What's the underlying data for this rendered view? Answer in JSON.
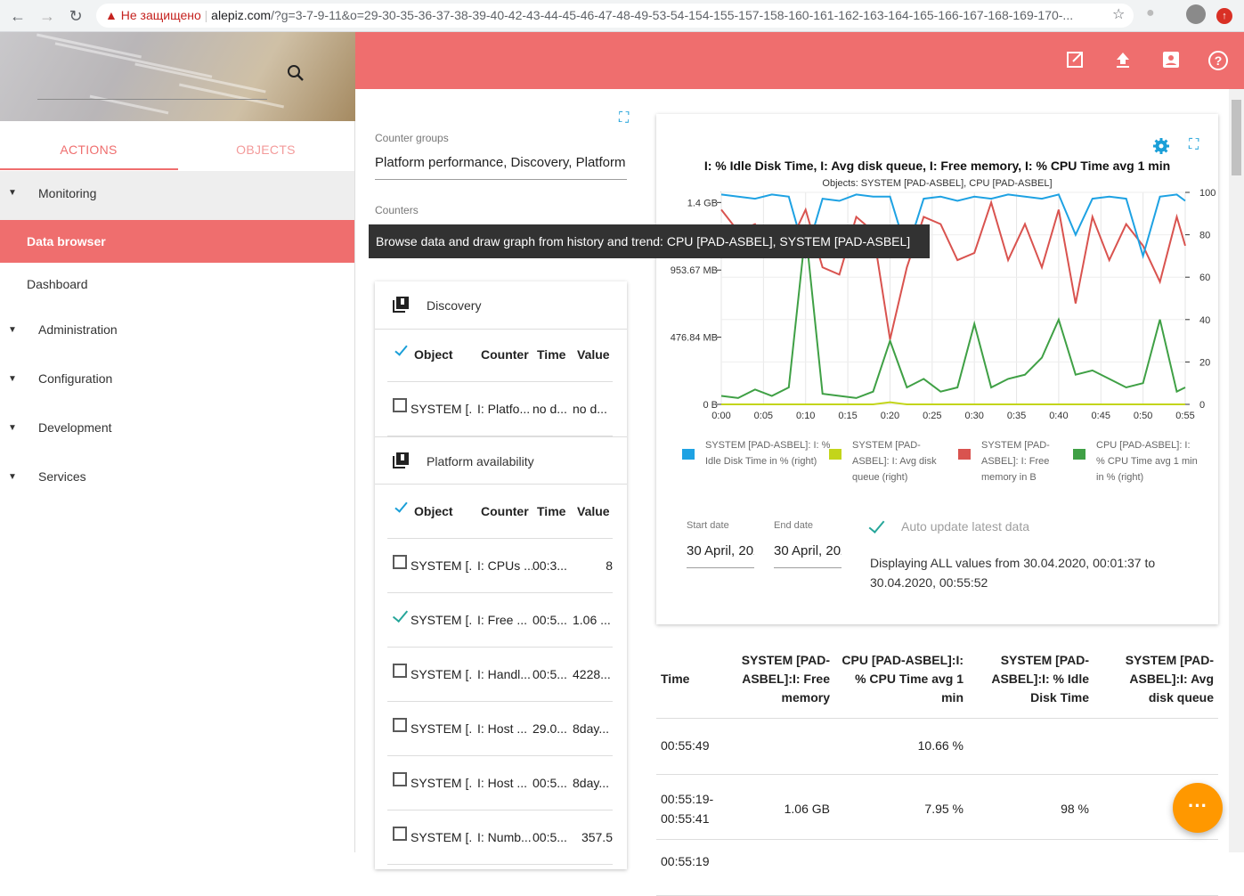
{
  "browser": {
    "warning": "Не защищено",
    "url_host": "alepiz.com",
    "url_path": "/?g=3-7-9-11&o=29-30-35-36-37-38-39-40-42-43-44-45-46-47-48-49-53-54-154-155-157-158-160-161-162-163-164-165-166-167-168-169-170-..."
  },
  "sidebar": {
    "tabs": [
      "ACTIONS",
      "OBJECTS"
    ],
    "menu": {
      "monitoring": "Monitoring",
      "data_browser": "Data browser",
      "dashboard": "Dashboard",
      "administration": "Administration",
      "configuration": "Configuration",
      "development": "Development",
      "services": "Services"
    }
  },
  "form": {
    "counter_groups_label": "Counter groups",
    "counter_groups_value": "Platform performance, Discovery, Platform availability",
    "counters_label": "Counters"
  },
  "tooltip": "Browse data and draw graph from history and trend: CPU [PAD-ASBEL], SYSTEM [PAD-ASBEL]",
  "counters": {
    "discovery": {
      "title": "Discovery",
      "headers": [
        "Object",
        "Counter",
        "Time",
        "Value"
      ],
      "rows": [
        {
          "object": "SYSTEM [...",
          "counter": "I: Platfo...",
          "time": "no d...",
          "value": "no d...",
          "checked": false
        }
      ]
    },
    "availability": {
      "title": "Platform availability",
      "headers": [
        "Object",
        "Counter",
        "Time",
        "Value"
      ],
      "rows": [
        {
          "object": "SYSTEM [...",
          "counter": "I: CPUs ...",
          "time": "00:3...",
          "value": "8"
        },
        {
          "object": "SYSTEM [...",
          "counter": "I: Free ...",
          "time": "00:5...",
          "value": "1.06 ..."
        },
        {
          "object": "SYSTEM [...",
          "counter": "I: Handl...",
          "time": "00:5...",
          "value": "4228..."
        },
        {
          "object": "SYSTEM [...",
          "counter": "I: Host ...",
          "time": "29.0...",
          "value": "8day..."
        },
        {
          "object": "SYSTEM [...",
          "counter": "I: Host ...",
          "time": "00:5...",
          "value": "8day..."
        },
        {
          "object": "SYSTEM [...",
          "counter": "I: Numb...",
          "time": "00:5...",
          "value": "357.5"
        }
      ]
    }
  },
  "chart": {
    "title": "I: % Idle Disk Time, I: Avg disk queue, I: Free memory, I: % CPU Time avg 1 min",
    "subtitle": "Objects: SYSTEM [PAD-ASBEL], CPU [PAD-ASBEL]",
    "legend": [
      {
        "label": "SYSTEM [PAD-ASBEL]: I: % Idle Disk Time in % (right)",
        "color": "#1ea2e3"
      },
      {
        "label": "SYSTEM [PAD-ASBEL]: I: Avg disk queue (right)",
        "color": "#c3d51b"
      },
      {
        "label": "SYSTEM [PAD-ASBEL]: I: Free memory in B",
        "color": "#d9534f"
      },
      {
        "label": "CPU [PAD-ASBEL]: I: % CPU Time avg 1 min in % (right)",
        "color": "#3fa045"
      }
    ],
    "start_date_label": "Start date",
    "start_date": "30 April, 2020",
    "end_date_label": "End date",
    "end_date": "30 April, 2020",
    "auto_update": "Auto update latest data",
    "displaying": "Displaying ALL values from 30.04.2020, 00:01:37 to 30.04.2020, 00:55:52"
  },
  "chart_data": {
    "type": "line",
    "title": "I: % Idle Disk Time, I: Avg disk queue, I: Free memory, I: % CPU Time avg 1 min",
    "x_ticks": [
      "0:00",
      "0:05",
      "0:10",
      "0:15",
      "0:20",
      "0:25",
      "0:30",
      "0:35",
      "0:40",
      "0:45",
      "0:50",
      "0:55"
    ],
    "y_left_ticks": [
      "0 B",
      "476.84 MB",
      "953.67 MB",
      "1.4 GB"
    ],
    "y_right_ticks": [
      "0",
      "20",
      "40",
      "60",
      "80",
      "100"
    ],
    "x_minutes": [
      0,
      2,
      4,
      6,
      8,
      10,
      12,
      14,
      16,
      18,
      20,
      22,
      24,
      26,
      28,
      30,
      32,
      34,
      36,
      38,
      40,
      42,
      44,
      46,
      48,
      50,
      52,
      54,
      55
    ],
    "series": [
      {
        "name": "SYSTEM [PAD-ASBEL]: I: % Idle Disk Time in % (right)",
        "axis": "right",
        "values": [
          99,
          98,
          97,
          99,
          98,
          70,
          97,
          96,
          99,
          98,
          98,
          72,
          97,
          98,
          96,
          98,
          97,
          99,
          98,
          97,
          99,
          80,
          97,
          98,
          97,
          70,
          98,
          99,
          96
        ]
      },
      {
        "name": "SYSTEM [PAD-ASBEL]: I: Avg disk queue (right)",
        "axis": "right",
        "values": [
          0,
          0,
          0,
          0,
          0,
          0,
          0,
          0,
          0,
          0,
          1,
          0,
          0,
          0,
          0,
          0,
          0,
          0,
          0,
          0,
          0,
          0,
          0,
          0,
          0,
          0,
          0,
          0,
          0
        ]
      },
      {
        "name": "SYSTEM [PAD-ASBEL]: I: Free memory in B",
        "axis": "left",
        "values": [
          1.35,
          1.2,
          1.25,
          1.05,
          1.1,
          1.35,
          0.95,
          0.9,
          1.3,
          1.2,
          0.45,
          0.95,
          1.3,
          1.25,
          1.0,
          1.05,
          1.4,
          1.0,
          1.25,
          0.95,
          1.35,
          0.7,
          1.3,
          1.0,
          1.25,
          1.1,
          0.85,
          1.3,
          1.1
        ]
      },
      {
        "name": "CPU [PAD-ASBEL]: I: % CPU Time avg 1 min in % (right)",
        "axis": "right",
        "values": [
          4,
          3,
          7,
          4,
          8,
          82,
          5,
          4,
          3,
          6,
          30,
          8,
          12,
          6,
          8,
          38,
          8,
          12,
          14,
          22,
          40,
          14,
          16,
          12,
          8,
          10,
          40,
          6,
          8
        ]
      }
    ]
  },
  "table": {
    "headers": [
      "Time",
      "SYSTEM [PAD-ASBEL]:I: Free memory",
      "CPU [PAD-ASBEL]:I: % CPU Time avg 1 min",
      "SYSTEM [PAD-ASBEL]:I: % Idle Disk Time",
      "SYSTEM [PAD-ASBEL]:I: Avg disk queue"
    ],
    "rows": [
      {
        "time": "00:55:49",
        "free": "",
        "cpu": "10.66 %",
        "idle": "",
        "queue": ""
      },
      {
        "time": "00:55:19-00:55:41",
        "free": "1.06 GB",
        "cpu": "7.95 %",
        "idle": "98 %",
        "queue": ""
      },
      {
        "time": "00:55:19",
        "free": "",
        "cpu": "",
        "idle": "",
        "queue": ""
      }
    ]
  }
}
